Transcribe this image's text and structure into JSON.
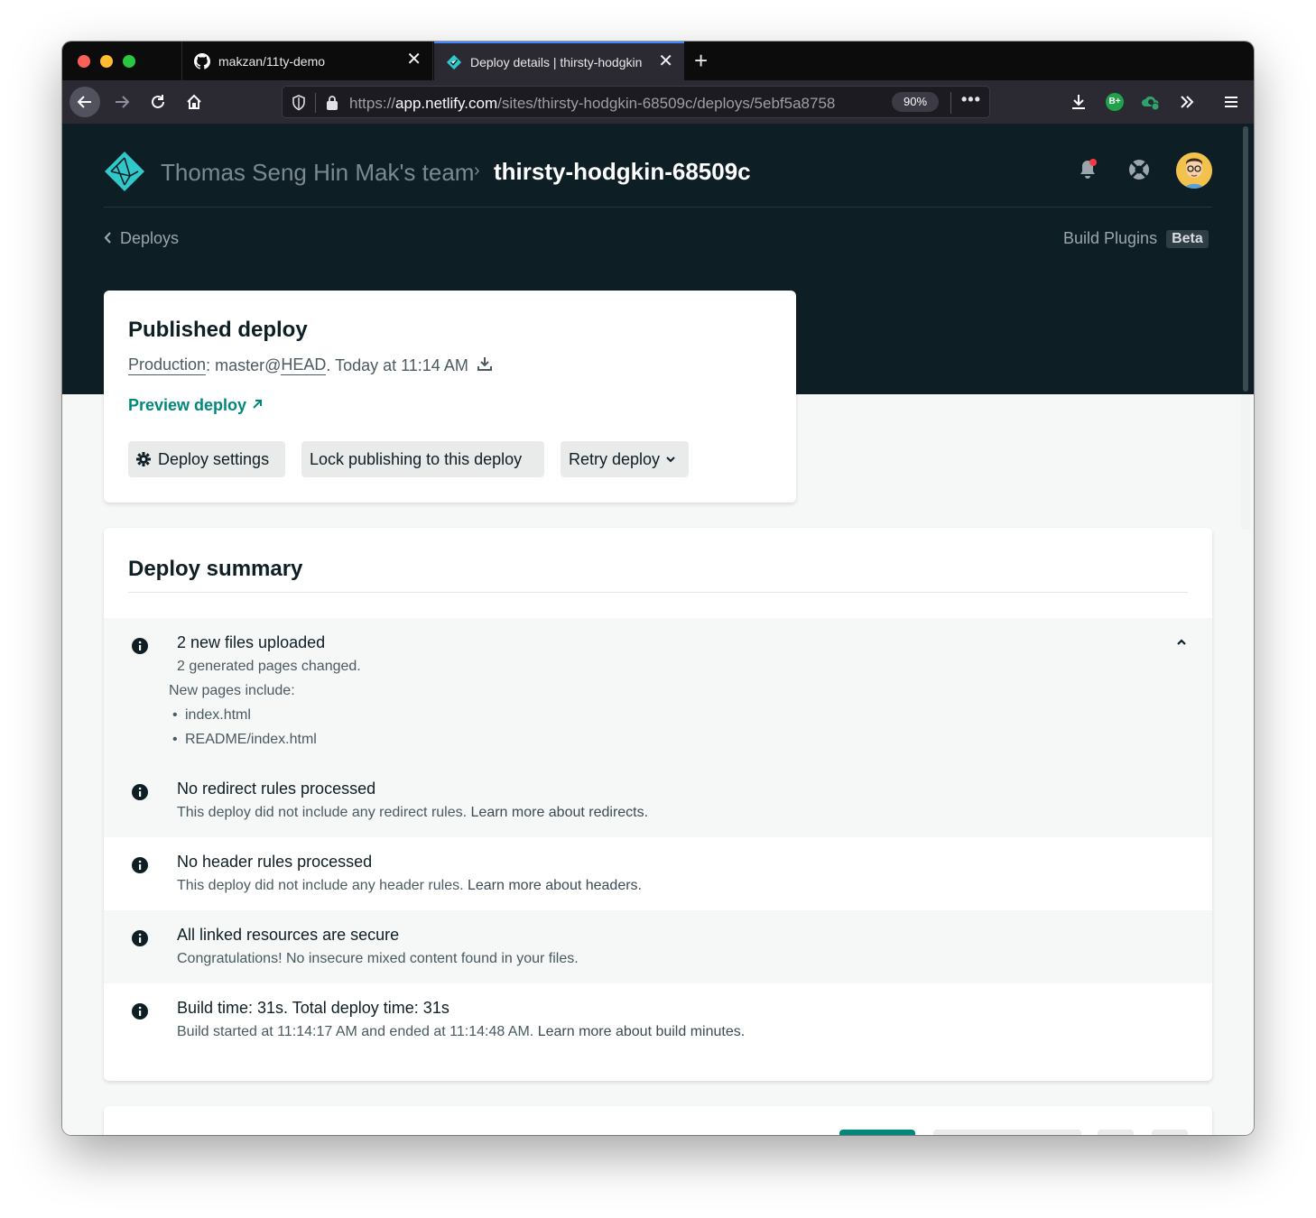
{
  "browser": {
    "tabs": [
      {
        "label": "makzan/11ty-demo",
        "icon": "github-icon",
        "active": false
      },
      {
        "label": "Deploy details | thirsty-hodgkin",
        "icon": "netlify-icon",
        "active": true
      }
    ],
    "new_tab_glyph": "+",
    "close_glyph": "✕",
    "url_prefix": "https://",
    "url_host": "app.netlify.com",
    "url_path": "/sites/thirsty-hodgkin-68509c/deploys/5ebf5a8758",
    "zoom": "90%",
    "more_glyph": "•••",
    "extension_badge": "B+"
  },
  "header": {
    "team": "Thomas Seng Hin Mak's team",
    "separator": "›",
    "site": "thirsty-hodgkin-68509c",
    "back_label": "Deploys",
    "build_plugins": "Build Plugins",
    "beta": "Beta"
  },
  "published": {
    "title": "Published deploy",
    "context": "Production",
    "branch": "master@",
    "ref": "HEAD",
    "time": ". Today at 11:14 AM",
    "preview_label": "Preview deploy",
    "buttons": {
      "settings": "Deploy settings",
      "lock": "Lock publishing to this deploy",
      "retry": "Retry deploy"
    }
  },
  "summary": {
    "title": "Deploy summary",
    "items": [
      {
        "title": "2 new files uploaded",
        "desc": "2 generated pages changed.",
        "new_pages_label": "New pages include:",
        "pages": [
          "index.html",
          "README/index.html"
        ]
      },
      {
        "title": "No redirect rules processed",
        "desc": "This deploy did not include any redirect rules.",
        "link": "Learn more about redirects."
      },
      {
        "title": "No header rules processed",
        "desc": "This deploy did not include any header rules.",
        "link": "Learn more about headers."
      },
      {
        "title": "All linked resources are secure",
        "desc": "Congratulations! No insecure mixed content found in your files."
      },
      {
        "title": "Build time: 31s. Total deploy time: 31s",
        "desc": "Build started at 11:14:17 AM and ended at 11:14:48 AM.",
        "link": "Learn more about build minutes."
      }
    ]
  },
  "colors": {
    "header_bg": "#0e1e25",
    "accent": "#00897b",
    "brand": "#30c8c9"
  }
}
